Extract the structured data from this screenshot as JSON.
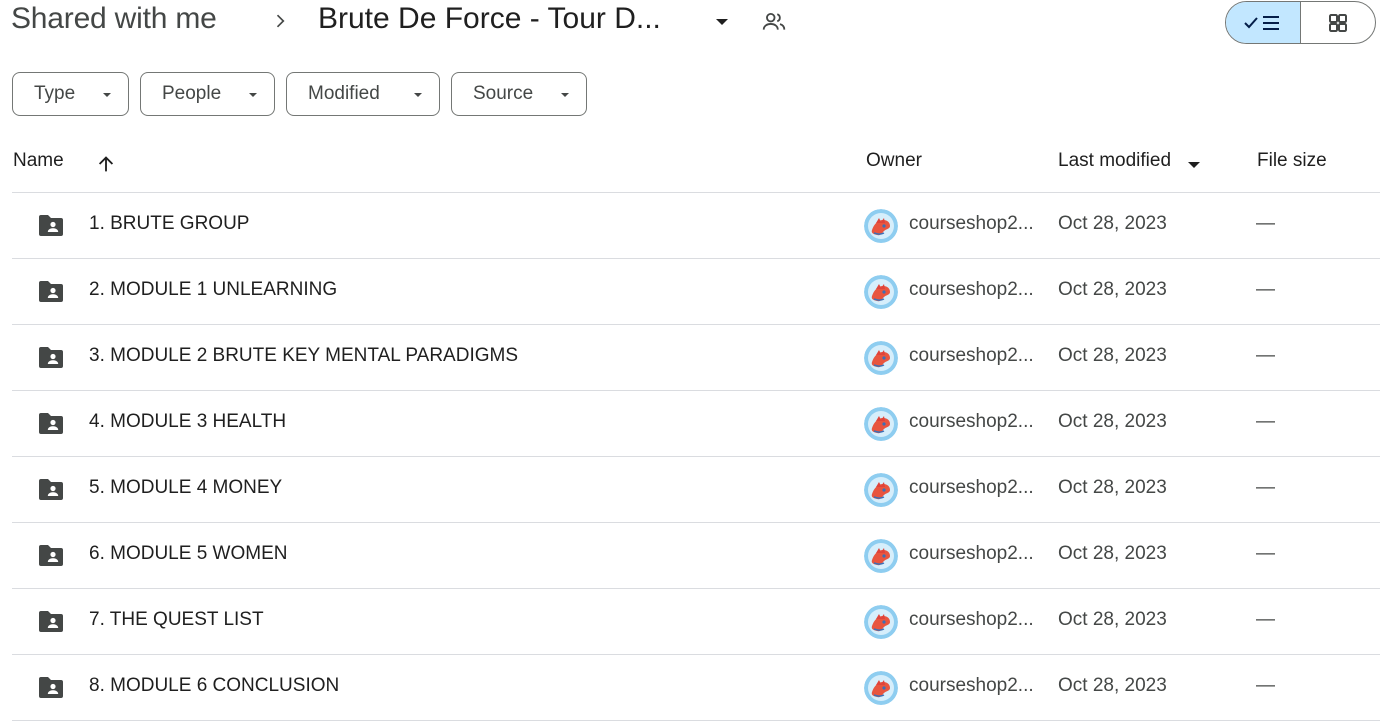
{
  "breadcrumb": {
    "root": "Shared with me",
    "current": "Brute De Force - Tour D..."
  },
  "filters": [
    {
      "label": "Type"
    },
    {
      "label": "People"
    },
    {
      "label": "Modified"
    },
    {
      "label": "Source"
    }
  ],
  "columns": {
    "name": "Name",
    "owner": "Owner",
    "modified": "Last modified",
    "size": "File size"
  },
  "rows": [
    {
      "name": "1. BRUTE GROUP",
      "owner": "courseshop2...",
      "modified": "Oct 28, 2023",
      "size": "—"
    },
    {
      "name": "2. MODULE 1 UNLEARNING",
      "owner": "courseshop2...",
      "modified": "Oct 28, 2023",
      "size": "—"
    },
    {
      "name": "3. MODULE 2 BRUTE KEY MENTAL PARADIGMS",
      "owner": "courseshop2...",
      "modified": "Oct 28, 2023",
      "size": "—"
    },
    {
      "name": "4. MODULE 3 HEALTH",
      "owner": "courseshop2...",
      "modified": "Oct 28, 2023",
      "size": "—"
    },
    {
      "name": "5. MODULE 4 MONEY",
      "owner": "courseshop2...",
      "modified": "Oct 28, 2023",
      "size": "—"
    },
    {
      "name": "6. MODULE 5 WOMEN",
      "owner": "courseshop2...",
      "modified": "Oct 28, 2023",
      "size": "—"
    },
    {
      "name": "7. THE QUEST LIST",
      "owner": "courseshop2...",
      "modified": "Oct 28, 2023",
      "size": "—"
    },
    {
      "name": "8. MODULE 6 CONCLUSION",
      "owner": "courseshop2...",
      "modified": "Oct 28, 2023",
      "size": "—"
    }
  ],
  "icons": {
    "breadcrumb_separator": "chevron-right-icon",
    "breadcrumb_dropdown": "caret-down-icon",
    "shared": "people-icon",
    "list_view": "checkmark-list-icon",
    "grid_view": "grid-icon",
    "sort": "arrow-up-icon",
    "folder": "shared-folder-icon"
  },
  "colors": {
    "toggle_active": "#c2e7ff",
    "folder": "#444746",
    "divider": "#dadce0"
  }
}
